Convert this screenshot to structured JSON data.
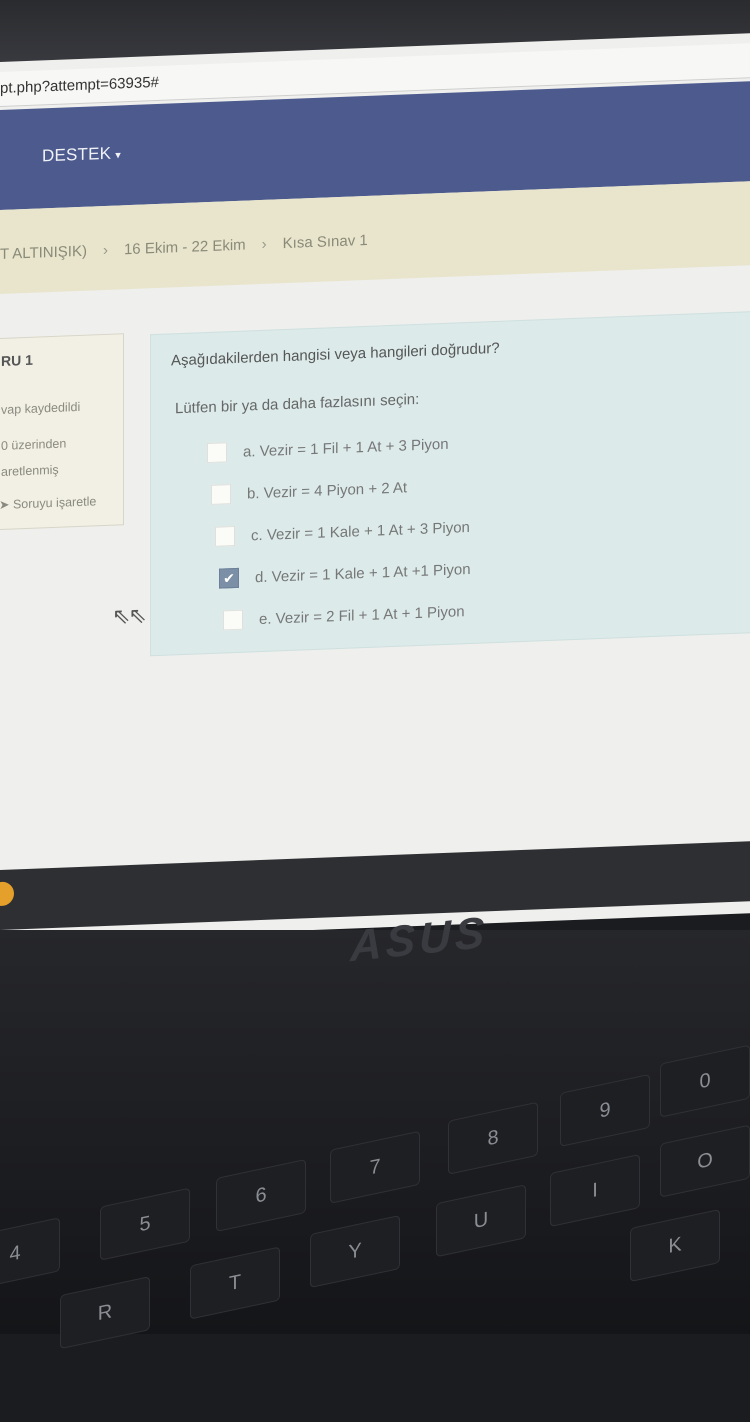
{
  "browser": {
    "url": "pt.php?attempt=63935#"
  },
  "navbar": {
    "menu_label": "DESTEK",
    "caret": "▾"
  },
  "breadcrumb": {
    "items": [
      "T ALTINIŞIK)",
      "16 Ekim - 22 Ekim",
      "Kısa Sınav 1"
    ],
    "separator": "›"
  },
  "info_panel": {
    "question_label": "RU 1",
    "status": "vap kaydedildi",
    "points": "0 üzerinden",
    "marked": "aretlenmiş",
    "flag_label": "Soruyu işaretle"
  },
  "question": {
    "text": "Aşağıdakilerden hangisi veya hangileri doğrudur?",
    "prompt": "Lütfen bir ya da daha fazlasını seçin:",
    "options": [
      {
        "label": "a. Vezir = 1 Fil + 1 At + 3 Piyon",
        "checked": false
      },
      {
        "label": "b. Vezir = 4 Piyon + 2 At",
        "checked": false
      },
      {
        "label": "c. Vezir = 1 Kale + 1 At + 3 Piyon",
        "checked": false
      },
      {
        "label": "d. Vezir = 1 Kale + 1 At +1 Piyon",
        "checked": true
      },
      {
        "label": "e. Vezir = 2 Fil + 1 At + 1 Piyon",
        "checked": false
      }
    ]
  },
  "laptop": {
    "brand": "ASUS",
    "keys": [
      "4",
      "5",
      "6",
      "7",
      "8",
      "9",
      "0",
      "R",
      "T",
      "Y",
      "U",
      "I",
      "O",
      "K"
    ]
  }
}
